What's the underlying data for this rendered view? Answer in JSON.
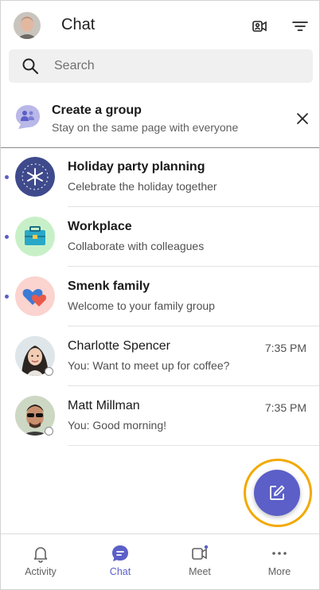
{
  "header": {
    "title": "Chat",
    "icons": [
      "avatar",
      "video-call-icon",
      "filter-icon"
    ]
  },
  "search": {
    "placeholder": "Search"
  },
  "banner": {
    "title": "Create a group",
    "subtitle": "Stay on the same page with everyone",
    "icon": "group-chat-icon",
    "close_icon": "close-icon"
  },
  "chats": [
    {
      "name": "Holiday party planning",
      "preview": "Celebrate the holiday together",
      "unread": true,
      "time": ""
    },
    {
      "name": "Workplace",
      "preview": "Collaborate with colleagues",
      "unread": true,
      "time": ""
    },
    {
      "name": "Smenk family",
      "preview": "Welcome to your family group",
      "unread": true,
      "time": ""
    },
    {
      "name": "Charlotte Spencer",
      "preview": "You: Want to meet up for coffee?",
      "unread": false,
      "time": "7:35 PM"
    },
    {
      "name": "Matt Millman",
      "preview": "You: Good morning!",
      "unread": false,
      "time": "7:35 PM"
    }
  ],
  "fab": {
    "icon": "compose-icon"
  },
  "nav": [
    {
      "label": "Activity",
      "icon": "bell-icon"
    },
    {
      "label": "Chat",
      "icon": "chat-icon",
      "active": true
    },
    {
      "label": "Meet",
      "icon": "video-icon"
    },
    {
      "label": "More",
      "icon": "more-icon"
    }
  ],
  "colors": {
    "accent": "#5b5fc7",
    "highlight": "#f2a900"
  }
}
